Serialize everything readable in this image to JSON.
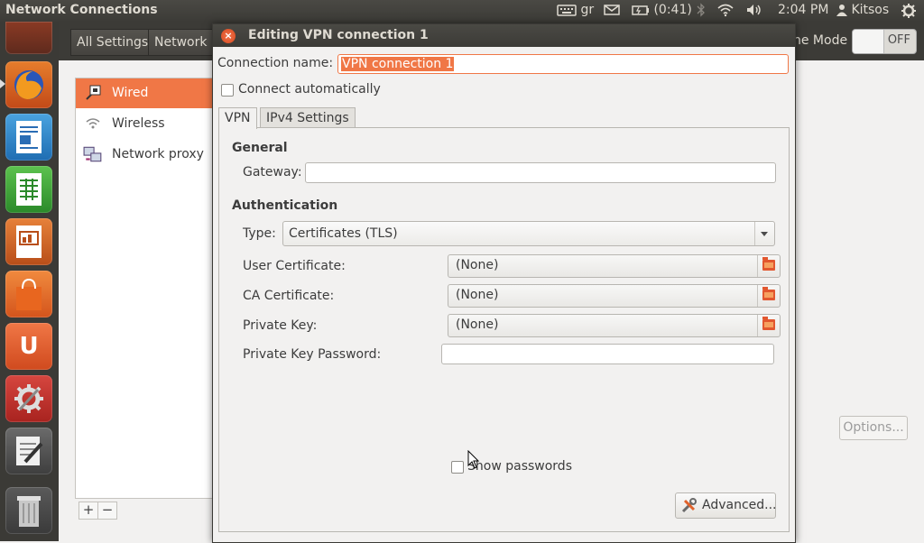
{
  "topbar": {
    "app_title": "Network Connections",
    "keyboard_layout": "gr",
    "battery": "(0:41)",
    "time": "2:04 PM",
    "user": "Kitsos"
  },
  "launcher": {
    "items": [
      "dash-home",
      "firefox",
      "libreoffice-writer",
      "libreoffice-calc",
      "libreoffice-impress",
      "ubuntu-software-center",
      "ubuntu-one",
      "system-settings",
      "text-editor",
      "trash"
    ]
  },
  "settings": {
    "breadcrumb_all": "All Settings",
    "breadcrumb_network": "Network",
    "airplane_mode_label": "ne Mode",
    "airplane_toggle": "OFF",
    "devices": [
      "Wired",
      "Wireless",
      "Network proxy"
    ],
    "add": "+",
    "remove": "−",
    "options_button": "Options..."
  },
  "dialog": {
    "title": "Editing VPN connection 1",
    "connection_name_label": "Connection name:",
    "connection_name_value": "VPN connection 1",
    "connect_auto_label": "Connect automatically",
    "tabs": [
      "VPN",
      "IPv4 Settings"
    ],
    "general_heading": "General",
    "gateway_label": "Gateway:",
    "gateway_value": "",
    "auth_heading": "Authentication",
    "type_label": "Type:",
    "type_value": "Certificates (TLS)",
    "user_cert_label": "User Certificate:",
    "user_cert_value": "(None)",
    "ca_cert_label": "CA Certificate:",
    "ca_cert_value": "(None)",
    "private_key_label": "Private Key:",
    "private_key_value": "(None)",
    "private_key_password_label": "Private Key Password:",
    "private_key_password_value": "",
    "show_passwords_label": "Show passwords",
    "advanced_button": "Advanced..."
  },
  "colors": {
    "accent": "#f07746",
    "panel": "#3c3b37",
    "window_bg": "#f2f1f0"
  }
}
